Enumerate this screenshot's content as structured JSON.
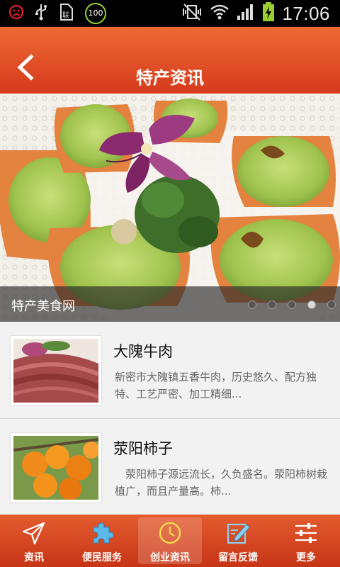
{
  "status_bar": {
    "time": "17:06",
    "battery_badge": "100",
    "icons": [
      "sad-face-icon",
      "usb-icon",
      "sim-icon",
      "battery-100-icon",
      "vibrate-off-icon",
      "wifi-icon",
      "signal-icon",
      "battery-charging-icon"
    ]
  },
  "header": {
    "title": "特产资讯",
    "back_icon": "back-arrow-icon"
  },
  "banner": {
    "caption": "特产美食网",
    "page_count": 5,
    "active_index": 3
  },
  "articles": [
    {
      "title": "大隗牛肉",
      "desc": "新密市大隗镇五香牛肉，历史悠久、配方独特、工艺严密、加工精细..."
    },
    {
      "title": "荥阳柿子",
      "desc": "　荥阳柿子源远流长，久负盛名。荥阳柿树栽植广，而且产量高。柿..."
    }
  ],
  "tabs": [
    {
      "label": "资讯",
      "icon": "paper-plane-icon"
    },
    {
      "label": "便民服务",
      "icon": "puzzle-icon"
    },
    {
      "label": "创业资讯",
      "icon": "clock-icon"
    },
    {
      "label": "留言反馈",
      "icon": "edit-icon"
    },
    {
      "label": "更多",
      "icon": "sliders-icon"
    }
  ],
  "active_tab": 2,
  "colors": {
    "header": "#e04a22",
    "tabbar": "#d84422",
    "background": "#efefef"
  }
}
